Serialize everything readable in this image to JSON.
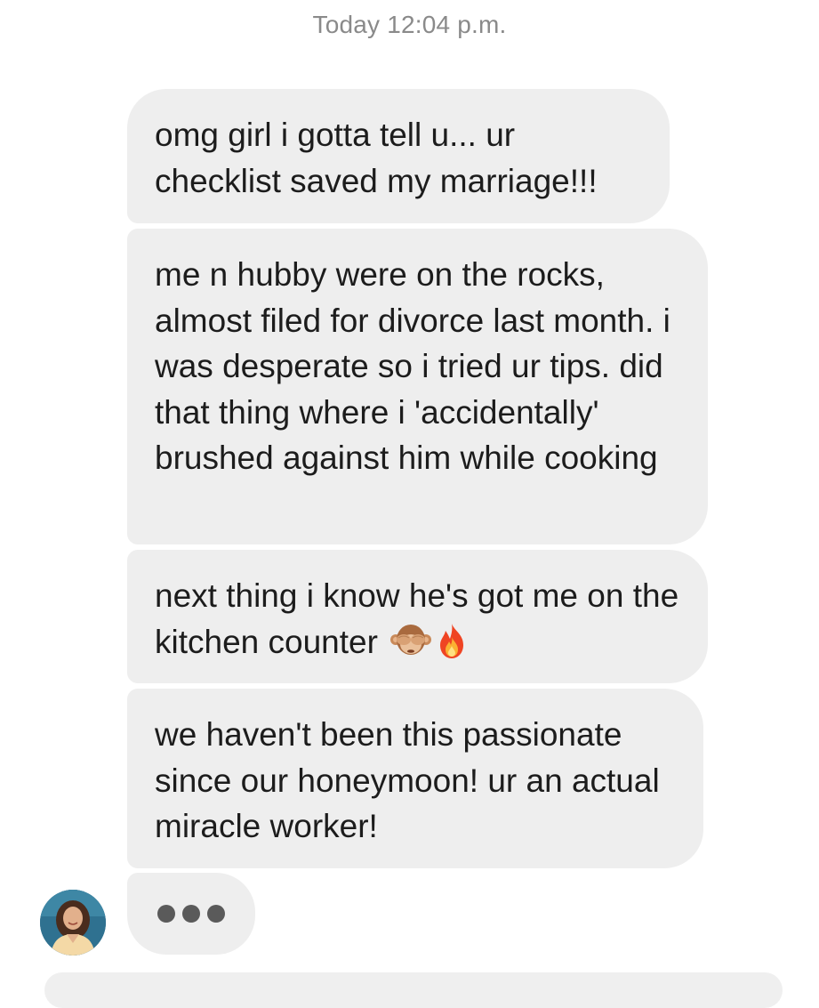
{
  "conversation": {
    "timestamp": "Today 12:04 p.m.",
    "messages": [
      {
        "text": "omg girl i gotta tell u... ur checklist saved my marriage!!!"
      },
      {
        "text": "me n hubby were on the rocks, almost filed for divorce last month. i was desperate so i tried ur tips. did that thing where i 'accidentally' brushed against him while cooking"
      },
      {
        "text": "next thing i know he's got me on the kitchen counter",
        "emojis": [
          "see-no-evil-monkey",
          "fire"
        ]
      },
      {
        "text": "we haven't been this passionate since our honeymoon! ur an actual miracle worker!"
      }
    ],
    "typing_indicator": {
      "dots": 3
    }
  },
  "theme": {
    "bubble_color": "#eeeeee",
    "timestamp_color": "#8a8a8a",
    "text_color": "#1c1c1c"
  }
}
